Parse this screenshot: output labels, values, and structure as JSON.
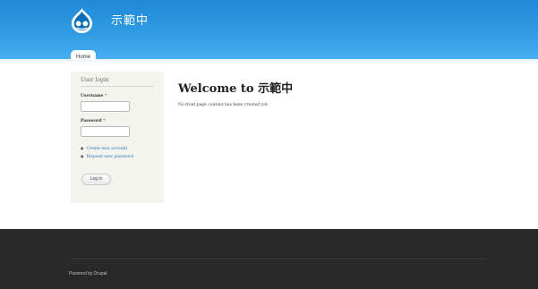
{
  "site": {
    "name": "示範中",
    "logo_icon": "drupal-drop-logo"
  },
  "nav": {
    "tabs": [
      {
        "label": "Home",
        "active": true
      }
    ]
  },
  "sidebar": {
    "login_block": {
      "title": "User login",
      "username_label": "Username",
      "username_value": "",
      "password_label": "Password",
      "password_value": "",
      "required_marker": "*",
      "links": [
        {
          "label": "Create new account"
        },
        {
          "label": "Request new password"
        }
      ],
      "submit_label": "Log in"
    }
  },
  "main": {
    "title": "Welcome to 示範中",
    "body": "No front page content has been created yet."
  },
  "footer": {
    "text": "Powered by Drupal"
  },
  "colors": {
    "header_blue": "#2f9be3",
    "sidebar_bg": "#f4f4ef",
    "link_blue": "#2a72b5",
    "footer_bg": "#292929",
    "required_red": "#e04848"
  }
}
